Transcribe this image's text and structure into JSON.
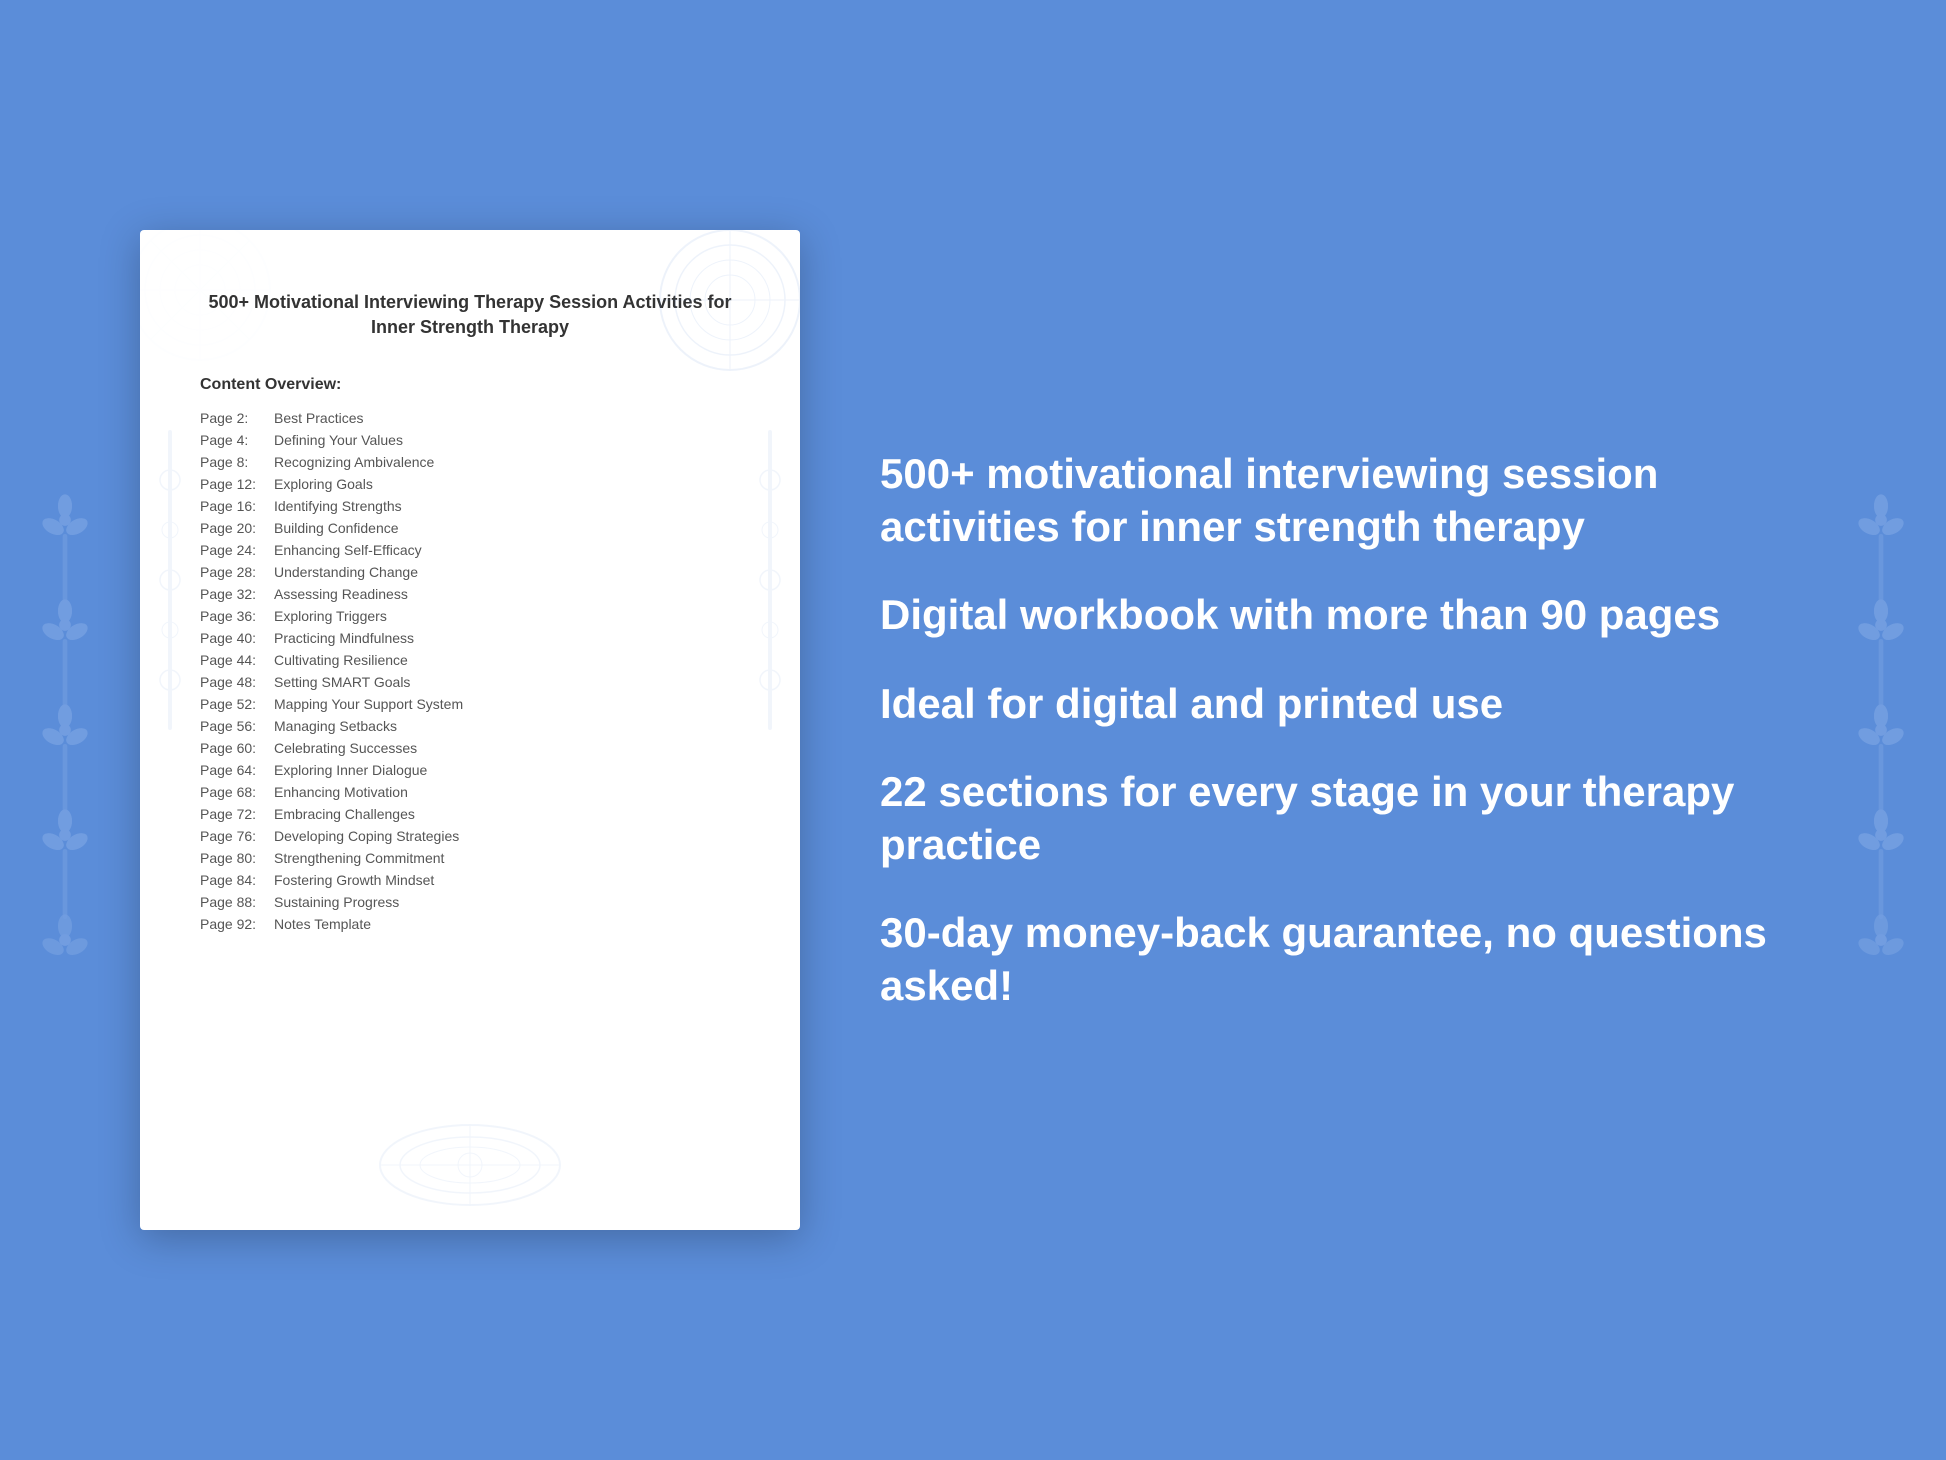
{
  "background": {
    "color": "#5b8dd9"
  },
  "document": {
    "title": "500+ Motivational Interviewing Therapy Session Activities for Inner Strength Therapy",
    "content_overview_label": "Content Overview:",
    "toc_items": [
      {
        "page": "Page  2:",
        "label": "Best Practices"
      },
      {
        "page": "Page  4:",
        "label": "Defining Your Values"
      },
      {
        "page": "Page  8:",
        "label": "Recognizing Ambivalence"
      },
      {
        "page": "Page 12:",
        "label": "Exploring Goals"
      },
      {
        "page": "Page 16:",
        "label": "Identifying Strengths"
      },
      {
        "page": "Page 20:",
        "label": "Building Confidence"
      },
      {
        "page": "Page 24:",
        "label": "Enhancing Self-Efficacy"
      },
      {
        "page": "Page 28:",
        "label": "Understanding Change"
      },
      {
        "page": "Page 32:",
        "label": "Assessing Readiness"
      },
      {
        "page": "Page 36:",
        "label": "Exploring Triggers"
      },
      {
        "page": "Page 40:",
        "label": "Practicing Mindfulness"
      },
      {
        "page": "Page 44:",
        "label": "Cultivating Resilience"
      },
      {
        "page": "Page 48:",
        "label": "Setting SMART Goals"
      },
      {
        "page": "Page 52:",
        "label": "Mapping Your Support System"
      },
      {
        "page": "Page 56:",
        "label": "Managing Setbacks"
      },
      {
        "page": "Page 60:",
        "label": "Celebrating Successes"
      },
      {
        "page": "Page 64:",
        "label": "Exploring Inner Dialogue"
      },
      {
        "page": "Page 68:",
        "label": "Enhancing Motivation"
      },
      {
        "page": "Page 72:",
        "label": "Embracing Challenges"
      },
      {
        "page": "Page 76:",
        "label": "Developing Coping Strategies"
      },
      {
        "page": "Page 80:",
        "label": "Strengthening Commitment"
      },
      {
        "page": "Page 84:",
        "label": "Fostering Growth Mindset"
      },
      {
        "page": "Page 88:",
        "label": "Sustaining Progress"
      },
      {
        "page": "Page 92:",
        "label": "Notes Template"
      }
    ]
  },
  "features": [
    "500+ motivational interviewing session activities for inner strength therapy",
    "Digital workbook with more than 90 pages",
    "Ideal for digital and printed use",
    "22 sections for every stage in your therapy practice",
    "30-day money-back guarantee, no questions asked!"
  ]
}
